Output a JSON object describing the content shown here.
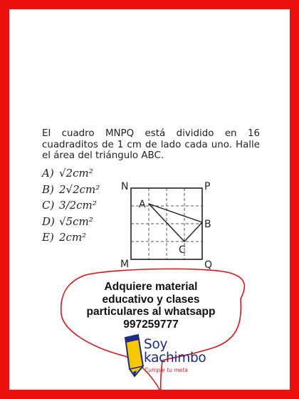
{
  "problem": {
    "statement": "El cuadro MNPQ está dividido en 16 cuadraditos de 1 cm de lado cada uno. Halle el área del triángulo ABC.",
    "options": [
      {
        "letter": "A)",
        "text": "√2cm²"
      },
      {
        "letter": "B)",
        "text": "2√2cm²"
      },
      {
        "letter": "C)",
        "text": "3/2cm²"
      },
      {
        "letter": "D)",
        "text": "√5cm²"
      },
      {
        "letter": "E)",
        "text": "2cm²"
      }
    ],
    "figure": {
      "vertex_labels": {
        "N": "N",
        "P": "P",
        "M": "M",
        "Q": "Q",
        "A": "A",
        "B": "B",
        "C": "C"
      }
    }
  },
  "promo": {
    "lines": [
      "Adquiere material",
      "educativo y clases",
      "particulares al whatsapp",
      "997259777"
    ],
    "brand_name_line1": "Soy",
    "brand_name_line2": "kachimbo",
    "brand_tagline": "Cumple tu meta"
  },
  "colors": {
    "frame": "#ee0f0f",
    "bubble_border": "#d51818",
    "brand_blue": "#1c2b84",
    "pencil_yellow": "#f5c800"
  }
}
